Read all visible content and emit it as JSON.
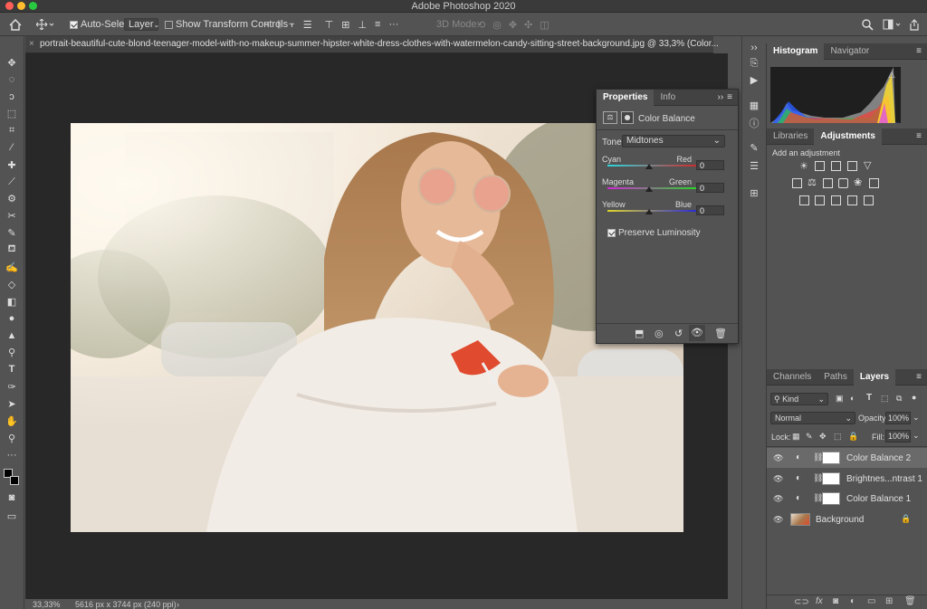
{
  "app_title": "Adobe Photoshop 2020",
  "options_bar": {
    "auto_select_label": "Auto-Select:",
    "auto_select_target": "Layer",
    "show_transform_label": "Show Transform Controls",
    "three_d_mode_label": "3D Mode:"
  },
  "document_tab": "portrait-beautiful-cute-blond-teenager-model-with-no-makeup-summer-hipster-white-dress-clothes-with-watermelon-candy-sitting-street-background.jpg @ 33,3% (Color...",
  "status": {
    "zoom": "33,33%",
    "doc_info": "5616 px x 3744 px (240 ppi)"
  },
  "properties": {
    "tabs": [
      "Properties",
      "Info"
    ],
    "adjustment_name": "Color Balance",
    "tone_label": "Tone:",
    "tone_value": "Midtones",
    "sliders": [
      {
        "left": "Cyan",
        "right": "Red",
        "value": "0",
        "level": 0
      },
      {
        "left": "Magenta",
        "right": "Green",
        "value": "0",
        "level": 0
      },
      {
        "left": "Yellow",
        "right": "Blue",
        "value": "0",
        "level": 0
      }
    ],
    "preserve_luminosity": "Preserve Luminosity"
  },
  "histogram_tabs": [
    "Histogram",
    "Navigator"
  ],
  "adjustments": {
    "tabs": [
      "Libraries",
      "Adjustments"
    ],
    "add_label": "Add an adjustment"
  },
  "layers_panel": {
    "tabs": [
      "Channels",
      "Paths",
      "Layers"
    ],
    "filter": "Kind",
    "blend_mode": "Normal",
    "opacity_label": "Opacity:",
    "opacity_value": "100%",
    "lock_label": "Lock:",
    "fill_label": "Fill:",
    "fill_value": "100%",
    "layers": [
      {
        "name": "Color Balance 2",
        "selected": true
      },
      {
        "name": "Brightnes...ntrast 1",
        "selected": false
      },
      {
        "name": "Color Balance 1",
        "selected": false
      },
      {
        "name": "Background",
        "selected": false
      }
    ]
  },
  "colors": {
    "panel": "#535353",
    "canvas": "#282828",
    "selected_layer": "#6a6a6a"
  }
}
